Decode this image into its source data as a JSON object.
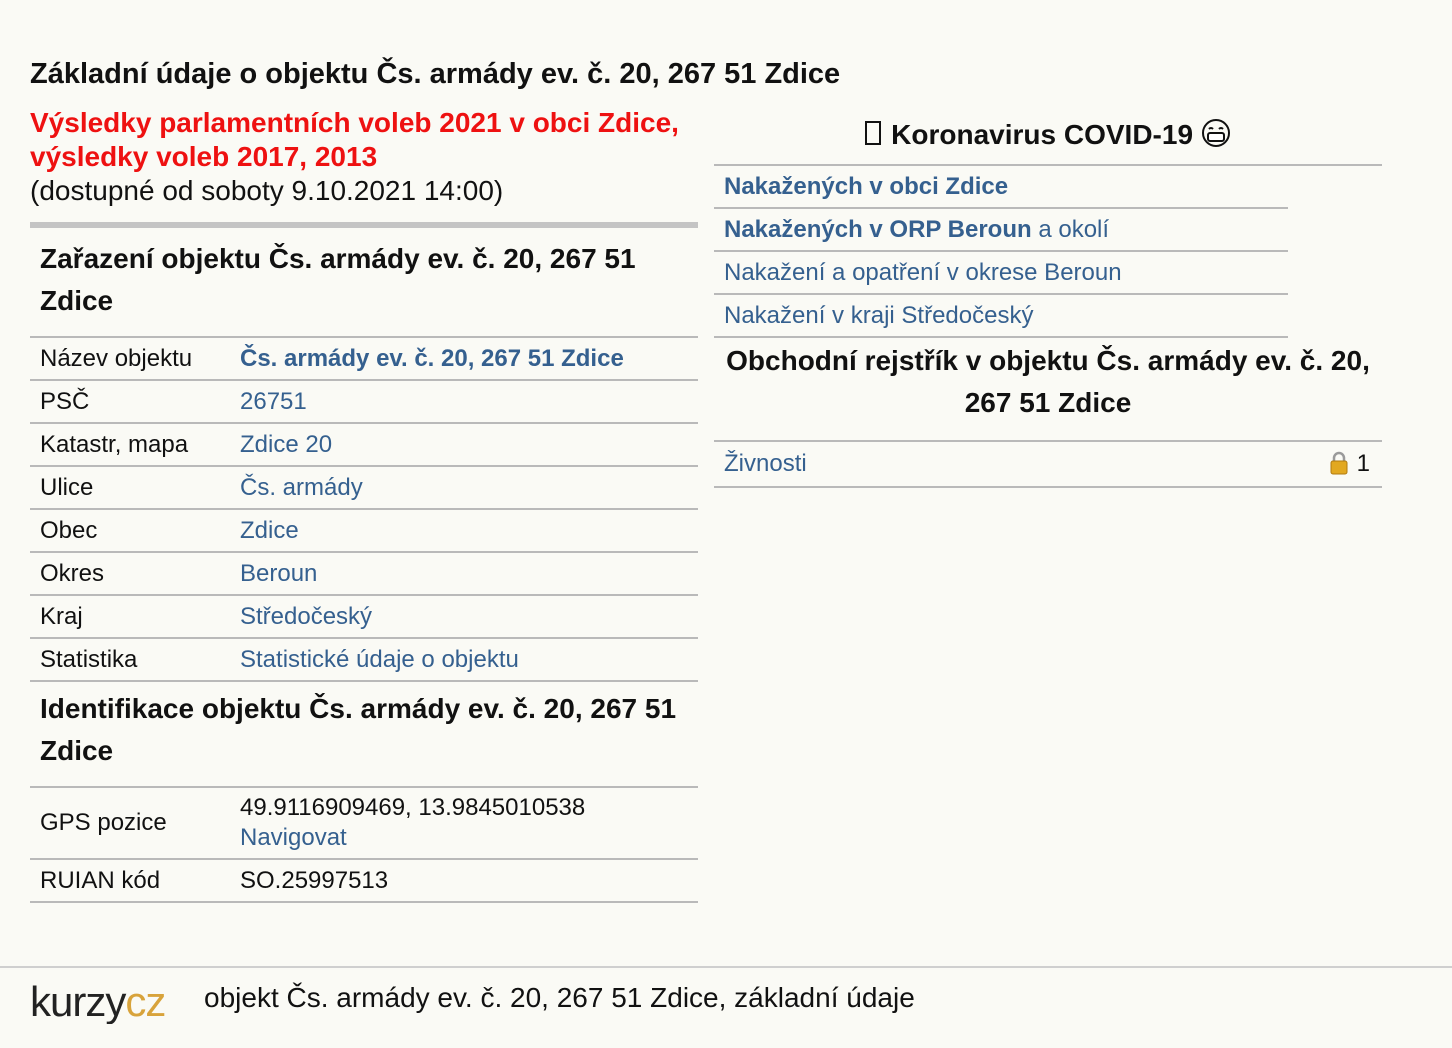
{
  "title": "Základní údaje o objektu Čs. armády ev. č. 20, 267 51 Zdice",
  "elections": {
    "link_text": "Výsledky parlamentních voleb 2021 v obci Zdice, výsledky voleb 2017, 2013",
    "availability": "(dostupné od soboty 9.10.2021 14:00)"
  },
  "classification": {
    "heading": "Zařazení objektu Čs. armády ev. č. 20, 267 51 Zdice",
    "rows": [
      {
        "key": "Název objektu",
        "value": "Čs. armády ev. č. 20, 267 51 Zdice"
      },
      {
        "key": "PSČ",
        "value": "26751"
      },
      {
        "key": "Katastr, mapa",
        "value": "Zdice 20"
      },
      {
        "key": "Ulice",
        "value": "Čs. armády"
      },
      {
        "key": "Obec",
        "value": "Zdice"
      },
      {
        "key": "Okres",
        "value": "Beroun"
      },
      {
        "key": "Kraj",
        "value": "Středočeský"
      },
      {
        "key": "Statistika",
        "value": "Statistické údaje o objektu"
      }
    ]
  },
  "identification": {
    "heading": "Identifikace objektu Čs. armády ev. č. 20, 267 51 Zdice",
    "gps_label": "GPS pozice",
    "gps_value": "49.9116909469, 13.9845010538",
    "navigate": "Navigovat",
    "ruian_label": "RUIAN kód",
    "ruian_value": "SO.25997513"
  },
  "covid": {
    "heading": "Koronavirus COVID-19",
    "items": [
      {
        "bold": "Nakažených v obci Zdice",
        "rest": ""
      },
      {
        "bold": "Nakažených v ORP Beroun",
        "rest": " a okolí"
      },
      {
        "bold": "",
        "rest": "Nakažení a opatření v okrese Beroun"
      },
      {
        "bold": "",
        "rest": "Nakažení v kraji Středočeský"
      }
    ]
  },
  "registry": {
    "heading": "Obchodní rejstřík v objektu Čs. armády ev. č. 20, 267 51 Zdice",
    "zivnosti_label": "Živnosti",
    "zivnosti_count": "1"
  },
  "footer": {
    "logo": "kurzycz",
    "text": "objekt Čs. armády ev. č. 20, 267 51 Zdice, základní údaje"
  },
  "colors": {
    "link": "#35608f",
    "election_red": "#ee1111",
    "background": "#fafaf5",
    "logo_gold": "#d8a33b"
  }
}
